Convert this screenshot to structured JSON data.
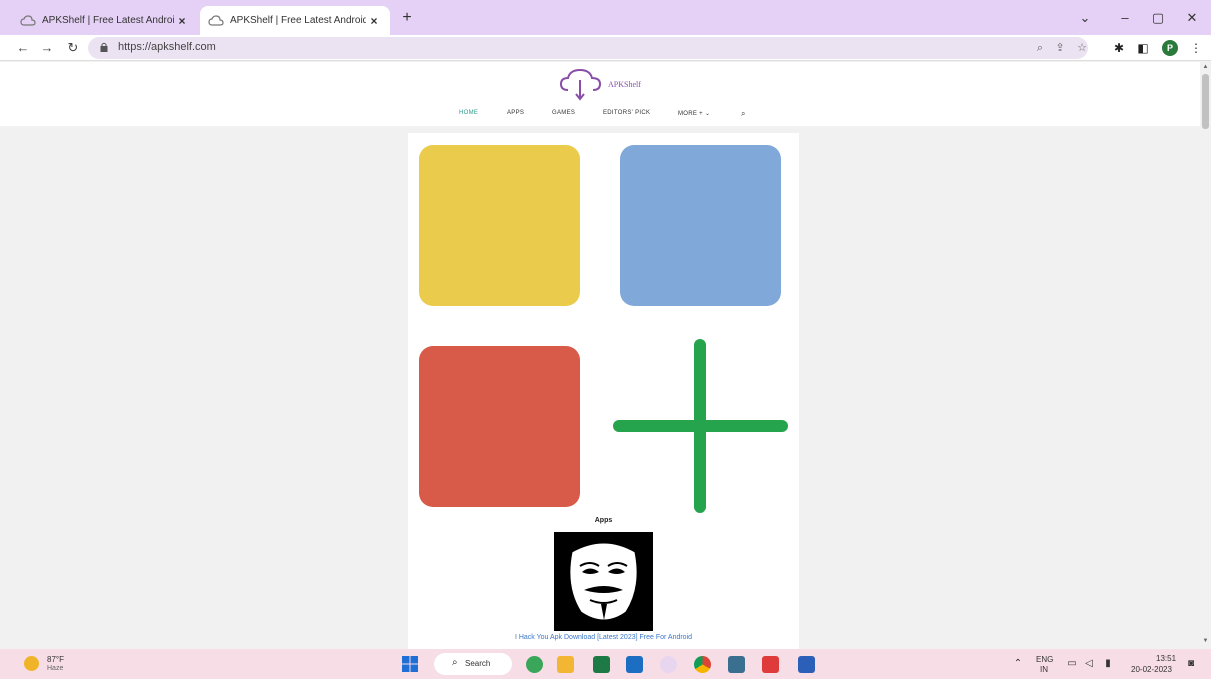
{
  "browser": {
    "tabs": [
      {
        "label": "APKShelf | Free Latest Android A",
        "active": false
      },
      {
        "label": "APKShelf | Free Latest Android A",
        "active": true
      }
    ],
    "close_glyph": "×",
    "new_tab_glyph": "+",
    "url": "https://apkshelf.com",
    "profile_initial": "P",
    "icons": [
      "back-icon",
      "forward-icon",
      "reload-icon",
      "lock-icon",
      "zoom-icon",
      "share-icon",
      "star-icon",
      "extensions-icon",
      "sidepanel-icon",
      "menu-icon"
    ],
    "window_buttons": [
      "chevron-down-icon",
      "minimize-icon",
      "restore-icon",
      "close-icon"
    ]
  },
  "site": {
    "logo_text": "APKShelf",
    "nav": [
      {
        "label": "HOME",
        "active": true
      },
      {
        "label": "APPS",
        "active": false
      },
      {
        "label": "GAMES",
        "active": false
      },
      {
        "label": "EDITORS' PICK",
        "active": false
      },
      {
        "label": "MORE + ⌄",
        "active": false
      }
    ],
    "colors": {
      "accent": "#2a9b8c",
      "yellow": "#ebcb4b",
      "blue": "#80a9d9",
      "red": "#d85a48",
      "green": "#25a34d",
      "logo": "#8a4ea8"
    },
    "section_title": "Apps",
    "featured_app": "I Hack You Apk Download [Latest 2023] Free For Android"
  },
  "taskbar": {
    "weather_temp": "87°F",
    "weather_desc": "Haze",
    "search_label": "Search",
    "lang_top": "ENG",
    "lang_bottom": "IN",
    "time": "13:51",
    "date": "20-02-2023"
  }
}
